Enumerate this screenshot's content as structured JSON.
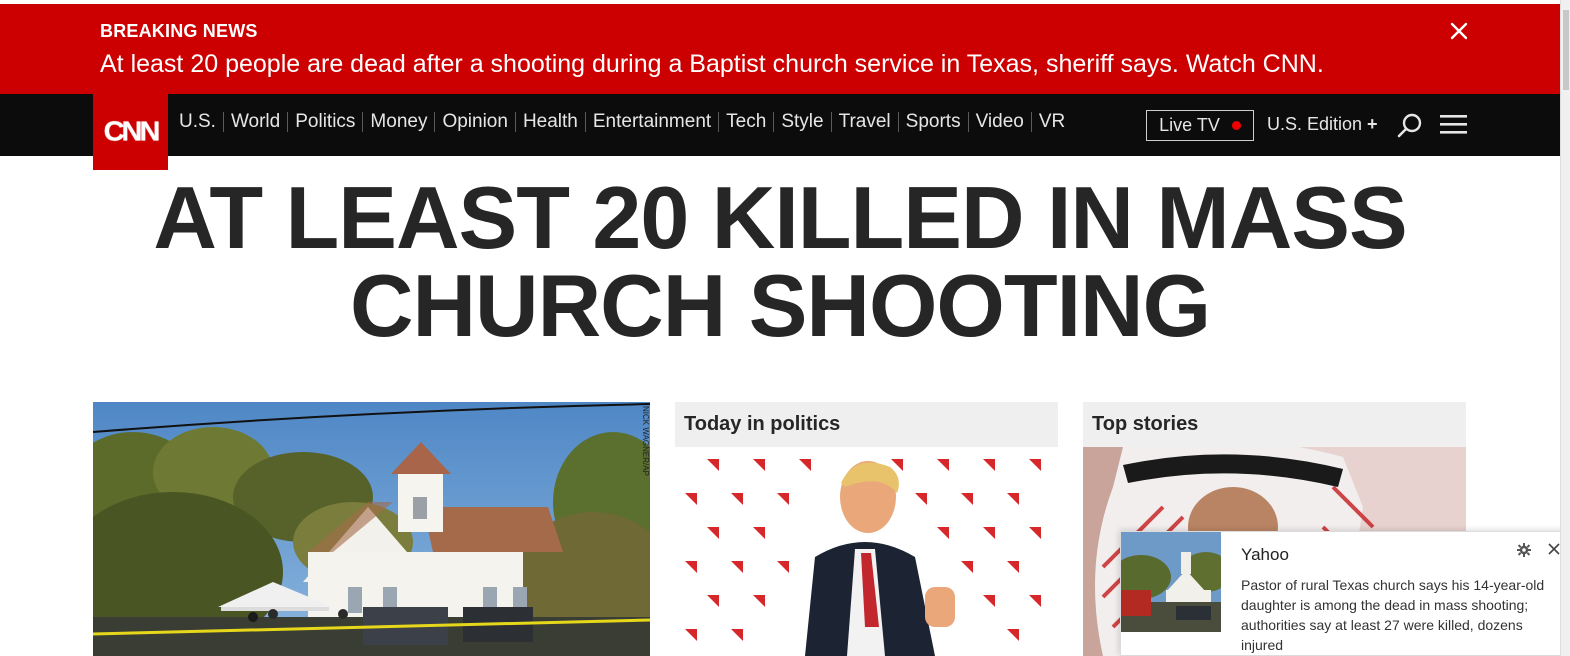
{
  "breaking": {
    "label": "BREAKING NEWS",
    "text": "At least 20 people are dead after a shooting during a Baptist church service in Texas, sheriff says. Watch CNN."
  },
  "nav": {
    "logo": "CNN",
    "links": [
      "U.S.",
      "World",
      "Politics",
      "Money",
      "Opinion",
      "Health",
      "Entertainment",
      "Tech",
      "Style",
      "Travel",
      "Sports",
      "Video",
      "VR"
    ],
    "live_tv": "Live TV",
    "edition": "U.S. Edition",
    "edition_plus": "+"
  },
  "headline": {
    "line1": "AT LEAST 20 KILLED IN MASS",
    "line2": "CHURCH SHOOTING"
  },
  "lead": {
    "photo_credit": "NICK WAGNER/AP"
  },
  "columns": {
    "politics_title": "Today in politics",
    "top_title": "Top stories"
  },
  "notification": {
    "source": "Yahoo",
    "body": "Pastor of rural Texas church says his 14-year-old daughter is among the dead in mass shooting; authorities say at least 27 were killed, dozens injured"
  },
  "colors": {
    "brand_red": "#cc0000",
    "nav_bg": "#0c0c0c",
    "headline": "#262626"
  }
}
